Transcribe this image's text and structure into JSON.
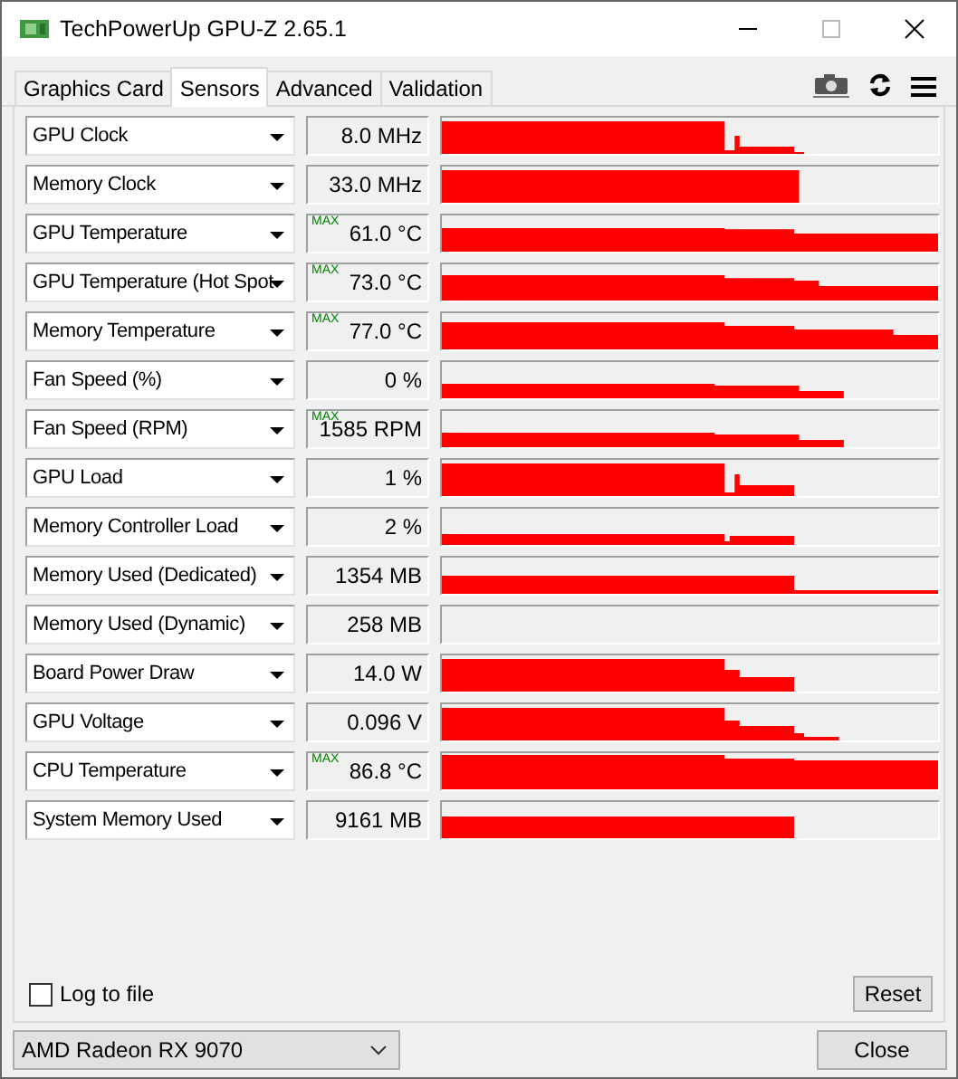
{
  "window": {
    "title": "TechPowerUp GPU-Z 2.65.1"
  },
  "tabs": [
    {
      "label": "Graphics Card",
      "selected": false
    },
    {
      "label": "Sensors",
      "selected": true
    },
    {
      "label": "Advanced",
      "selected": false
    },
    {
      "label": "Validation",
      "selected": false
    }
  ],
  "sensors": [
    {
      "name": "GPU Clock",
      "value": "8.0 MHz"
    },
    {
      "name": "Memory Clock",
      "value": "33.0 MHz"
    },
    {
      "name": "GPU Temperature",
      "value": "61.0 °C",
      "max_label": "MAX"
    },
    {
      "name": "GPU Temperature (Hot Spot",
      "value": "73.0 °C",
      "max_label": "MAX"
    },
    {
      "name": "Memory Temperature",
      "value": "77.0 °C",
      "max_label": "MAX"
    },
    {
      "name": "Fan Speed (%)",
      "value": "0 %"
    },
    {
      "name": "Fan Speed (RPM)",
      "value": "1585 RPM",
      "max_label": "MAX"
    },
    {
      "name": "GPU Load",
      "value": "1 %"
    },
    {
      "name": "Memory Controller Load",
      "value": "2 %"
    },
    {
      "name": "Memory Used (Dedicated)",
      "value": "1354 MB"
    },
    {
      "name": "Memory Used (Dynamic)",
      "value": "258 MB"
    },
    {
      "name": "Board Power Draw",
      "value": "14.0 W"
    },
    {
      "name": "GPU Voltage",
      "value": "0.096 V"
    },
    {
      "name": "CPU Temperature",
      "value": "86.8 °C",
      "max_label": "MAX"
    },
    {
      "name": "System Memory Used",
      "value": "9161 MB"
    }
  ],
  "log_to_file": {
    "label": "Log to file",
    "checked": false
  },
  "reset_button": "Reset",
  "device": "AMD Radeon RX 9070",
  "close_button": "Close"
}
